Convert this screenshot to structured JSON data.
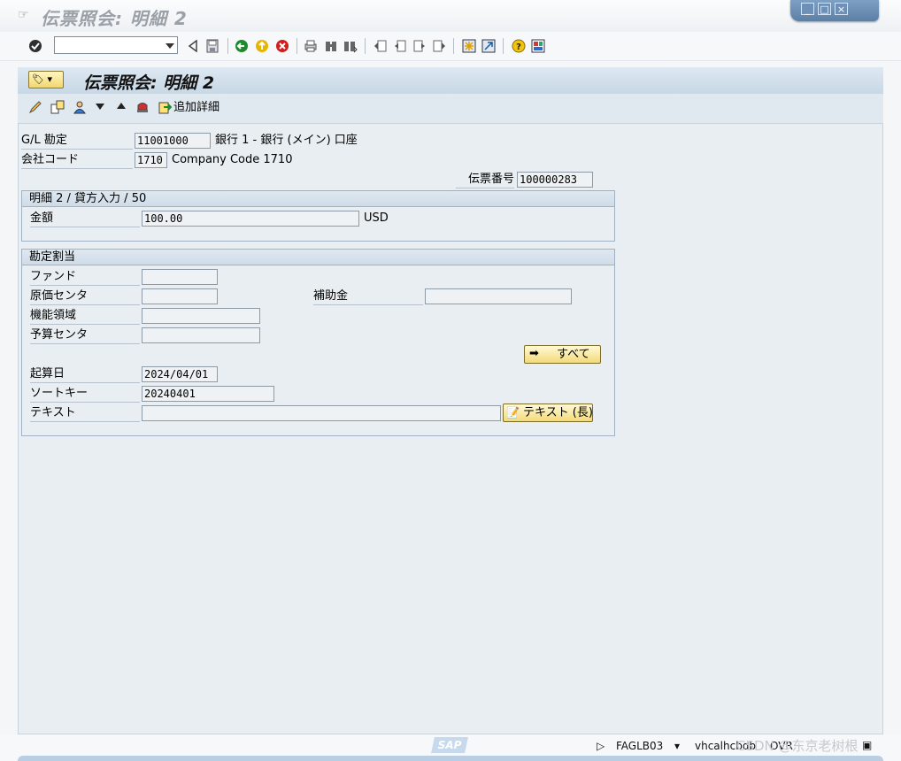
{
  "window": {
    "title": "伝票照会: 明細 2",
    "controls": [
      "minimize",
      "maximize",
      "close"
    ]
  },
  "toolbar": {
    "command_field": "",
    "icons": [
      "enter-icon",
      "back-arrow-icon",
      "save-icon",
      "back-icon",
      "exit-icon",
      "cancel-icon",
      "print-icon",
      "find-icon",
      "find-next-icon",
      "first-page-icon",
      "previous-page-icon",
      "next-page-icon",
      "last-page-icon",
      "new-session-icon",
      "shortcut-icon",
      "help-icon",
      "layout-icon"
    ]
  },
  "screen": {
    "title": "伝票照会: 明細 2",
    "app_toolbar": {
      "extra_details": "追加詳細"
    }
  },
  "header_fields": {
    "gl_account_label": "G/L 勘定",
    "gl_account_value": "11001000",
    "gl_account_text": "銀行 1 - 銀行 (メイン) 口座",
    "company_code_label": "会社コード",
    "company_code_value": "1710",
    "company_code_text": "Company Code 1710",
    "document_number_label": "伝票番号",
    "document_number_value": "100000283"
  },
  "item_group": {
    "title": "明細 2 / 貸方入力 / 50",
    "amount_label": "金額",
    "amount_value": "100.00",
    "currency": "USD"
  },
  "assignment_group": {
    "title": "勘定割当",
    "fund_label": "ファンド",
    "fund_value": "",
    "cost_center_label": "原価センタ",
    "cost_center_value": "",
    "grant_label": "補助金",
    "grant_value": "",
    "functional_area_label": "機能領域",
    "functional_area_value": "",
    "budget_center_label": "予算センタ",
    "budget_center_value": "",
    "all_button": "すべて",
    "value_date_label": "起算日",
    "value_date_value": "2024/04/01",
    "sort_key_label": "ソートキー",
    "sort_key_value": "20240401",
    "text_label": "テキスト",
    "text_value": "",
    "long_text_button": "テキスト (長)"
  },
  "status_bar": {
    "sap_logo": "SAP",
    "transaction": "FAGLB03",
    "server": "vhcalhcbdb",
    "mode": "OVR",
    "watermark": "CSDN @东京老树根"
  }
}
